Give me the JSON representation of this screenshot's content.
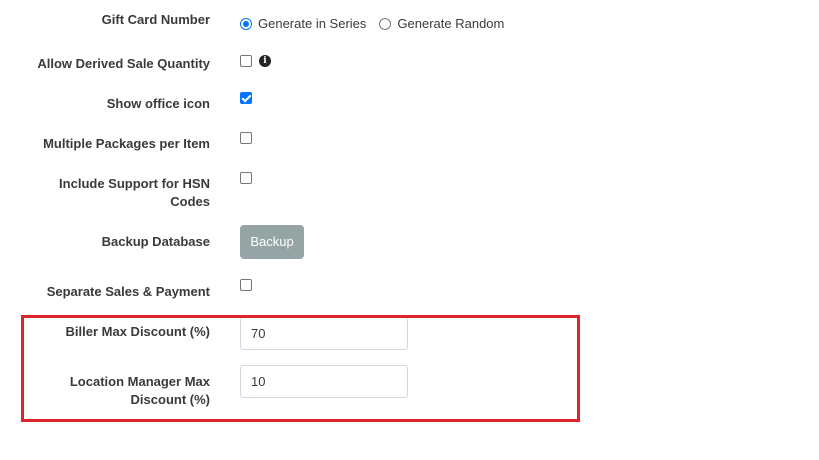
{
  "settings": {
    "gift_card_number": {
      "label": "Gift Card Number",
      "options": [
        {
          "label": "Generate in Series",
          "checked": true
        },
        {
          "label": "Generate Random",
          "checked": false
        }
      ]
    },
    "allow_derived_sale_quantity": {
      "label": "Allow Derived Sale Quantity",
      "checked": false,
      "icon": "info-icon"
    },
    "show_office_icon": {
      "label": "Show office icon",
      "checked": true
    },
    "multiple_packages_per_item": {
      "label": "Multiple Packages per Item",
      "checked": false
    },
    "include_support_hsn": {
      "label_line1": "Include Support for HSN",
      "label_line2": "Codes",
      "checked": false
    },
    "backup_database": {
      "label": "Backup Database",
      "button_label": "Backup"
    },
    "separate_sales_payment": {
      "label": "Separate Sales & Payment",
      "checked": false
    },
    "biller_max_discount": {
      "label": "Biller Max Discount (%)",
      "value": "70"
    },
    "location_manager_max_discount": {
      "label_line1": "Location Manager Max",
      "label_line2": "Discount (%)",
      "value": "10"
    }
  },
  "colors": {
    "highlight": "#e0242e",
    "accent": "#0075ff",
    "button": "#95a5a6"
  }
}
